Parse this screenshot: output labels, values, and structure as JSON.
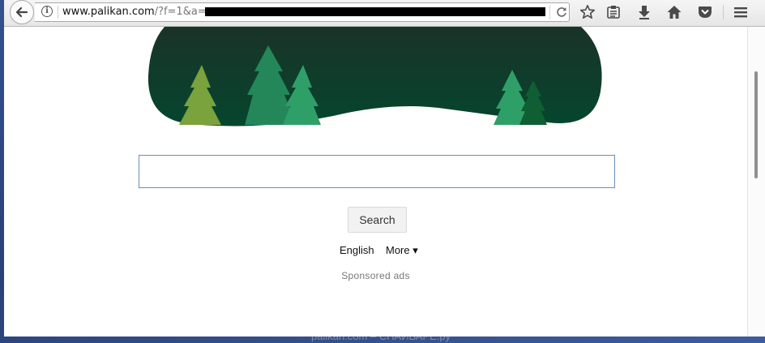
{
  "browser": {
    "url_host": "www.palikan.com",
    "url_rest": "/?f=1&a="
  },
  "page": {
    "search_placeholder": "",
    "search_button": "Search",
    "language_link": "English",
    "more_link": "More ▾",
    "sponsored_text": "Sponsored ads"
  },
  "watermark": "palikan.com – СПАЙВАРЕ.ру",
  "icons": [
    "back-arrow-icon",
    "info-icon",
    "reload-icon",
    "bookmark-star-icon",
    "reading-list-icon",
    "download-icon",
    "home-icon",
    "pocket-icon",
    "hamburger-menu-icon"
  ],
  "colors": {
    "banner_dark": "#0f3a26",
    "tree_green": "#2f9560",
    "tree_olive": "#7aa23d",
    "input_border": "#6a8fb8"
  }
}
